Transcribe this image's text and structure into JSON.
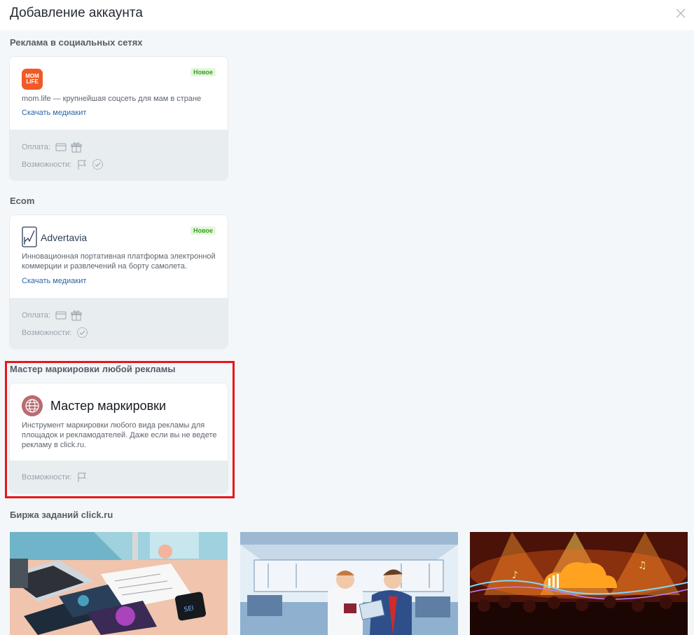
{
  "header": {
    "title": "Добавление аккаунта"
  },
  "sections": {
    "social": "Реклама в социальных сетях",
    "ecom": "Ecom",
    "master": "Мастер маркировки любой рекламы",
    "exchange": "Биржа заданий click.ru"
  },
  "cards": {
    "momlife": {
      "badge": "Новое",
      "logo_text_1": "MOM",
      "logo_text_2": "LIFE",
      "description": "mom.life — крупнейшая соцсеть для мам в стране",
      "link": "Скачать медиакит",
      "payment_label": "Оплата:",
      "features_label": "Возможности:"
    },
    "advertavia": {
      "badge": "Новое",
      "name": "Advertavia",
      "description": "Инновационная портативная платформа электронной коммерции и развлечений на борту самолета.",
      "link": "Скачать медиакит",
      "payment_label": "Оплата:",
      "features_label": "Возможности:"
    },
    "master": {
      "title": "Мастер маркировки",
      "description": "Инструмент маркировки любого вида рекламы для площадок и рекламодателей. Даже если вы не ведете рекламу в click.ru.",
      "features_label": "Возможности:"
    }
  },
  "colors": {
    "accent_link": "#2a66a8",
    "badge_green": "#35a31b",
    "highlight_red": "#e8161a",
    "momlife_orange": "#ef5a26"
  },
  "icons": {
    "close": "close-icon",
    "card": "card-icon",
    "gift": "gift-icon",
    "flag": "flag-icon",
    "check": "check-circle-icon",
    "globe": "globe-icon"
  }
}
